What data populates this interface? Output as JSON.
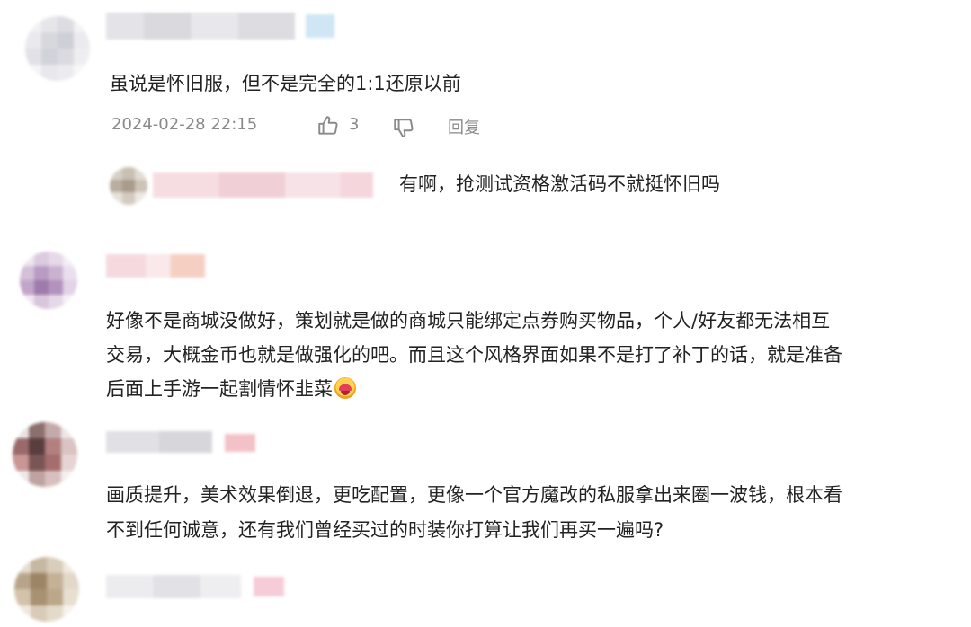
{
  "comments": [
    {
      "text_lines": [
        "虽说是怀旧服，但不是完全的1:1还原以前"
      ],
      "timestamp": "2024-02-28 22:15",
      "like_count": "3",
      "reply_label": "回复",
      "reply": {
        "text": "有啊，抢测试资格激活码不就挺怀旧吗"
      }
    },
    {
      "text_lines": [
        "好像不是商城没做好，策划就是做的商城只能绑定点券购买物品，个人/好友都无法相互",
        "交易，大概金币也就是做强化的吧。而且这个风格界面如果不是打了补丁的话，就是准备",
        "后面上手游一起割情怀韭菜"
      ]
    },
    {
      "text_lines": [
        "画质提升，美术效果倒退，更吃配置，更像一个官方魔改的私服拿出来圈一波钱，根本看",
        "不到任何诚意，还有我们曾经买过的时装你打算让我们再买一遍吗?"
      ]
    }
  ],
  "icons": {
    "like": "thumbs-up-icon",
    "dislike": "thumbs-down-icon",
    "emoji": "drooling-face-emoji"
  },
  "colors": {
    "text": "#222222",
    "meta": "#8a8a8a",
    "background": "#ffffff"
  }
}
